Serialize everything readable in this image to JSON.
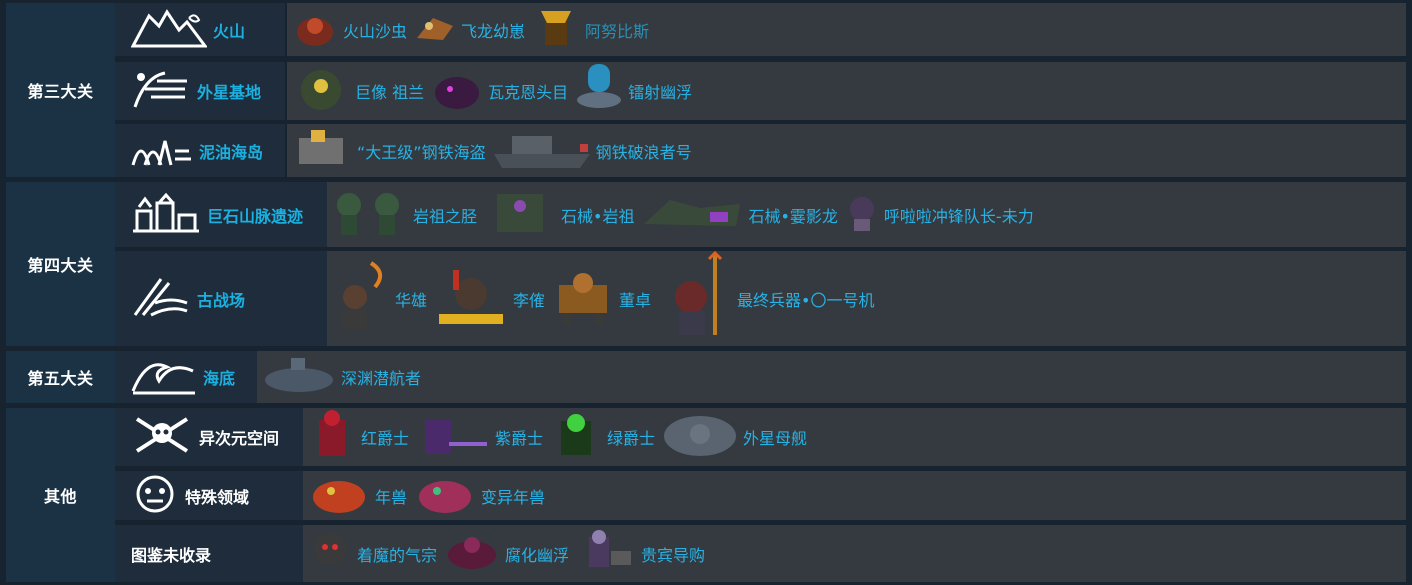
{
  "chapters": [
    {
      "label": "第三大关",
      "stages": [
        {
          "name": "火山",
          "icon": "volcano-icon",
          "bosses": [
            "火山沙虫",
            "飞龙幼崽",
            "阿努比斯"
          ]
        },
        {
          "name": "外星基地",
          "icon": "circuit-icon",
          "bosses": [
            "巨像 祖兰",
            "瓦克恩头目",
            "镭射幽浮"
          ]
        },
        {
          "name": "泥油海岛",
          "icon": "island-icon",
          "bosses": [
            "“大王级”钢铁海盗",
            "钢铁破浪者号"
          ]
        }
      ]
    },
    {
      "label": "第四大关",
      "stages": [
        {
          "name": "巨石山脉遗迹",
          "icon": "ruins-icon",
          "bosses": [
            "岩祖之胫",
            "石械•岩祖",
            "石械•霎影龙",
            "呼啦啦冲锋队长-未力"
          ]
        },
        {
          "name": "古战场",
          "icon": "battlefield-icon",
          "bosses": [
            "华雄",
            "李傕",
            "董卓",
            "最终兵器•〇一号机"
          ]
        }
      ]
    },
    {
      "label": "第五大关",
      "stages": [
        {
          "name": "海底",
          "icon": "wave-icon",
          "bosses": [
            "深渊潜航者"
          ]
        }
      ]
    },
    {
      "label": "其他",
      "stages": [
        {
          "name": "异次元空间",
          "icon": "crossed-swords-skull-icon",
          "bosses": [
            "红爵士",
            "紫爵士",
            "绿爵士",
            "外星母舰"
          ]
        },
        {
          "name": "特殊领域",
          "icon": "lion-mask-icon",
          "bosses": [
            "年兽",
            "变异年兽"
          ]
        },
        {
          "name": "图鉴未收录",
          "icon": "",
          "bosses": [
            "着魔的气宗",
            "腐化幽浮",
            "贵宾导购"
          ]
        }
      ]
    }
  ],
  "colors": {
    "background": "#17232f",
    "chapter_cell": "#1b3245",
    "stage_cell": "#1e2c3b",
    "boss_cell": "#343a40",
    "link_text": "#27b2e5"
  }
}
